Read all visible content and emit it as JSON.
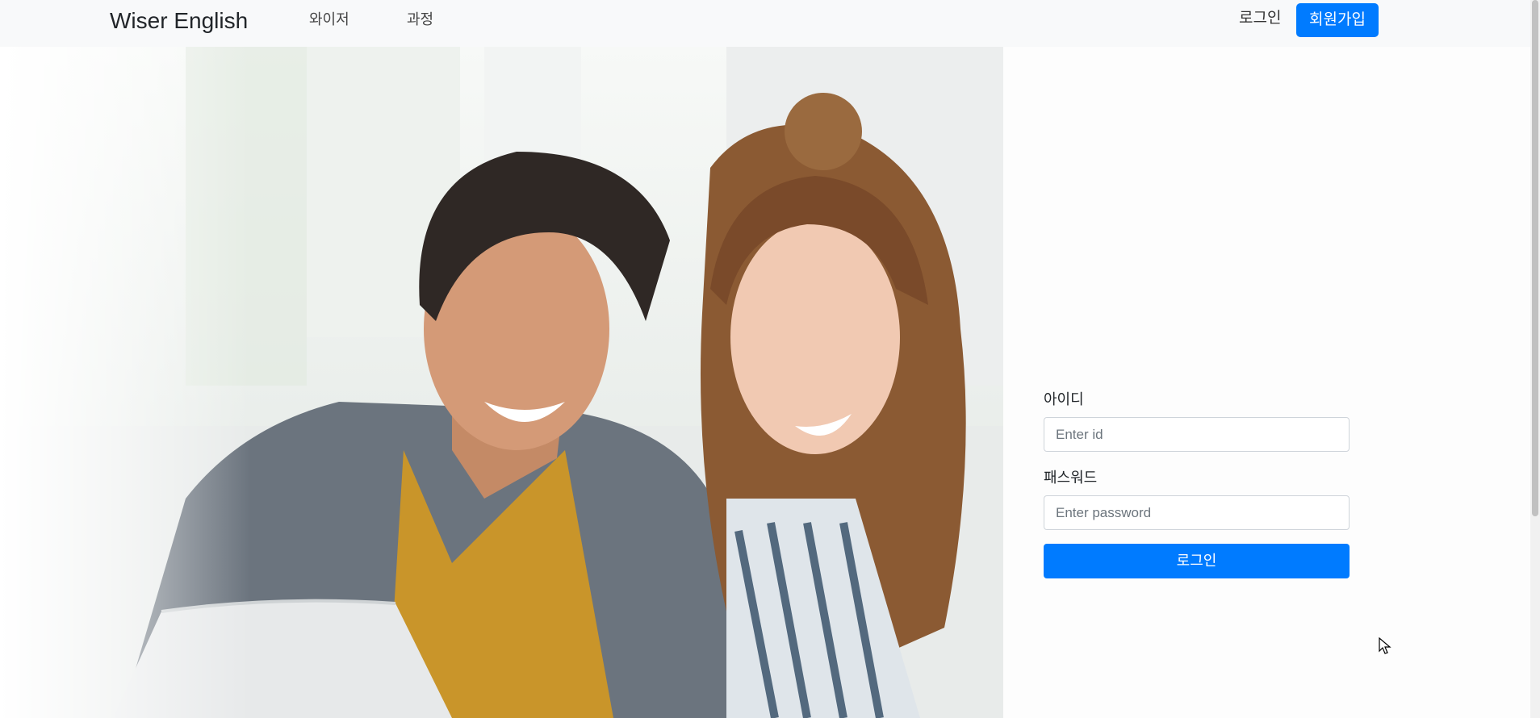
{
  "navbar": {
    "brand": "Wiser English",
    "links": [
      {
        "label": "와이저"
      },
      {
        "label": "과정"
      }
    ],
    "login_label": "로그인",
    "signup_label": "회원가입"
  },
  "login_form": {
    "id_label": "아이디",
    "id_placeholder": "Enter id",
    "password_label": "패스워드",
    "password_placeholder": "Enter password",
    "submit_label": "로그인"
  },
  "colors": {
    "primary": "#007bff",
    "navbar_bg": "#f8f9fa"
  }
}
